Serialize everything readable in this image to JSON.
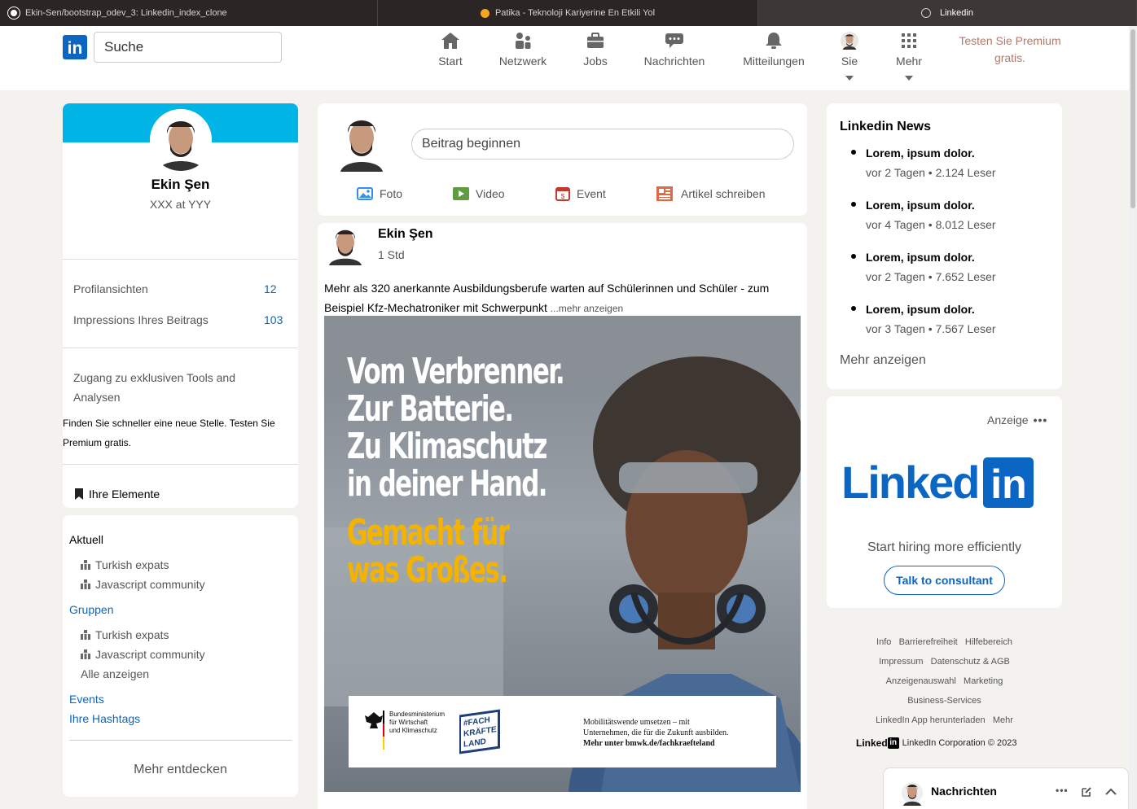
{
  "browser": {
    "tabs": [
      {
        "label": "Ekin-Sen/bootstrap_odev_3: Linkedin_index_clone",
        "icon": "github-icon"
      },
      {
        "label": "Patika - Teknoloji Kariyerine En Etkili Yol",
        "icon": "patika-icon"
      },
      {
        "label": "Linkedin",
        "icon": "compass-icon"
      }
    ]
  },
  "nav": {
    "logo": "in",
    "search_placeholder": "Suche",
    "items": [
      {
        "label": "Start",
        "icon": "home-icon"
      },
      {
        "label": "Netzwerk",
        "icon": "network-icon"
      },
      {
        "label": "Jobs",
        "icon": "briefcase-icon"
      },
      {
        "label": "Nachrichten",
        "icon": "message-icon"
      },
      {
        "label": "Mitteilungen",
        "icon": "bell-icon"
      },
      {
        "label": "Sie",
        "icon": "avatar-icon"
      },
      {
        "label": "Mehr",
        "icon": "grid-icon"
      }
    ],
    "premium": "Testen Sie Premium gratis."
  },
  "profile": {
    "name": "Ekin Şen",
    "headline": "XXX at YYY",
    "stats": [
      {
        "label": "Profilansichten",
        "value": "12"
      },
      {
        "label": "Impressions Ihres Beitrags",
        "value": "103"
      }
    ],
    "premium_teaser": "Zugang zu exklusiven Tools and Analysen",
    "premium_link": "Finden Sie schneller eine neue Stelle. Testen Sie Premium gratis.",
    "my_items": "Ihre Elemente"
  },
  "sidebar": {
    "recent_title": "Aktuell",
    "recent": [
      "Turkish expats",
      "Javascript community"
    ],
    "groups_title": "Gruppen",
    "groups": [
      "Turkish expats",
      "Javascript community"
    ],
    "show_all": "Alle anzeigen",
    "events": "Events",
    "hashtags": "Ihre Hashtags",
    "discover": "Mehr entdecken"
  },
  "composer": {
    "placeholder": "Beitrag beginnen",
    "actions": [
      {
        "label": "Foto",
        "icon": "photo-icon",
        "color": "#378fe9"
      },
      {
        "label": "Video",
        "icon": "video-icon",
        "color": "#5f9b41"
      },
      {
        "label": "Event",
        "icon": "calendar-icon",
        "color": "#c37d16"
      },
      {
        "label": "Artikel schreiben",
        "icon": "article-icon",
        "color": "#e06847"
      }
    ]
  },
  "post": {
    "author": "Ekin Şen",
    "time": "1 Std",
    "text": "Mehr als 320 anerkannte Ausbildungsberufe warten auf Schülerinnen und Schüler - zum Beispiel Kfz-Mechatroniker mit Schwerpunkt",
    "more": "...mehr anzeigen",
    "image": {
      "headline_lines": [
        "Vom Verbrenner.",
        "Zur Batterie.",
        "Zu Klimaschutz",
        "in deiner Hand."
      ],
      "tagline_lines": [
        "Gemacht für",
        "was Großes."
      ],
      "ministry_lines": [
        "Bundesministerium",
        "für Wirtschaft",
        "und Klimaschutz"
      ],
      "badge_lines": [
        "#FACH",
        "KRÄFTE",
        "LAND"
      ],
      "footer_lines": [
        "Mobilitätswende umsetzen – mit",
        "Unternehmen, die für die Zukunft ausbilden."
      ],
      "footer_link": "Mehr unter bmwk.de/fachkraefteland"
    }
  },
  "news": {
    "title": "Linkedin News",
    "items": [
      {
        "headline": "Lorem, ipsum dolor.",
        "meta": "vor 2 Tagen • 2.124 Leser"
      },
      {
        "headline": "Lorem, ipsum dolor.",
        "meta": "vor 4 Tagen • 8.012 Leser"
      },
      {
        "headline": "Lorem, ipsum dolor.",
        "meta": "vor 2 Tagen • 7.652 Leser"
      },
      {
        "headline": "Lorem, ipsum dolor.",
        "meta": "vor 3 Tagen • 7.567 Leser"
      }
    ],
    "more": "Mehr anzeigen"
  },
  "ad": {
    "label": "Anzeige",
    "logo_text": "Linked",
    "logo_box": "in",
    "tagline": "Start hiring more efficiently",
    "button": "Talk to consultant"
  },
  "footer": {
    "rows": [
      [
        "Info",
        "Barrierefreiheit",
        "Hilfebereich"
      ],
      [
        "Impressum",
        "Datenschutz & AGB"
      ],
      [
        "Anzeigenauswahl",
        "Marketing"
      ],
      [
        "Business-Services"
      ],
      [
        "LinkedIn App herunterladen",
        "Mehr"
      ]
    ],
    "brand": "Linked",
    "brand_box": "in",
    "copyright": "LinkedIn Corporation © 2023"
  },
  "messaging": {
    "title": "Nachrichten"
  },
  "colors": {
    "brand": "#0a66c2",
    "banner": "#00b4e6",
    "premium": "#b07a6b"
  }
}
